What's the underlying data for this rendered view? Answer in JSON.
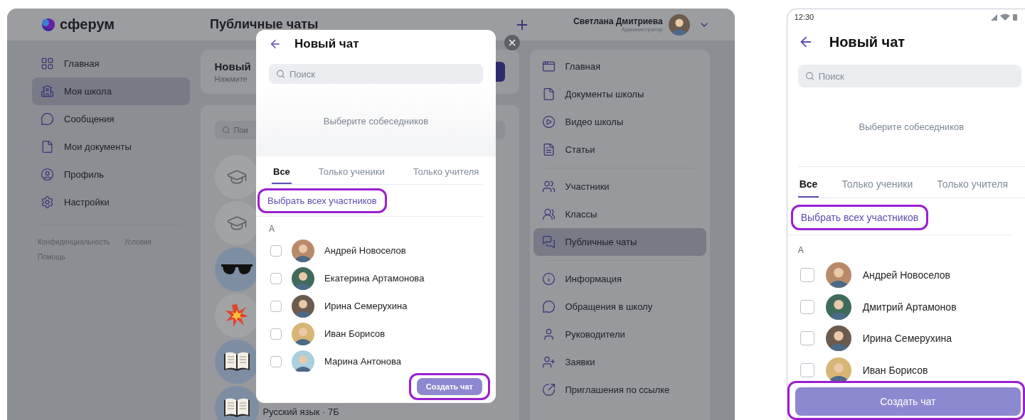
{
  "desktop": {
    "logo": "сферум",
    "page_title": "Публичные чаты",
    "user": {
      "name": "Светлана Дмитриева",
      "role": "Администратор"
    },
    "sidebar": {
      "items": [
        {
          "kind": "grid",
          "label": "Главная",
          "selected": false
        },
        {
          "kind": "school",
          "label": "Моя школа",
          "selected": true
        },
        {
          "kind": "chat",
          "label": "Сообщения",
          "selected": false
        },
        {
          "kind": "file",
          "label": "Мои документы",
          "selected": false
        },
        {
          "kind": "profile",
          "label": "Профиль",
          "selected": false
        },
        {
          "kind": "settings",
          "label": "Настройки",
          "selected": false
        }
      ],
      "links": [
        "Конфиденциальность",
        "Условия",
        "Помощь"
      ]
    },
    "new_chat_card": {
      "title": "Новый",
      "subtitle": "Нажмите"
    },
    "chat_list": {
      "search_placeholder": "Пои",
      "chats": [
        {
          "kind": "cap"
        },
        {
          "kind": "cap"
        },
        {
          "kind": "sunglasses"
        },
        {
          "kind": "explosion"
        },
        {
          "kind": "book"
        },
        {
          "kind": "book",
          "title": "Русский язык · 7Б"
        }
      ]
    },
    "school_menu": {
      "groups": [
        {
          "items": [
            {
              "kind": "window",
              "label": "Главная",
              "selected": false
            },
            {
              "kind": "file",
              "label": "Документы школы",
              "selected": false
            },
            {
              "kind": "play",
              "label": "Видео школы",
              "selected": false
            },
            {
              "kind": "article",
              "label": "Статьи",
              "selected": false
            }
          ]
        },
        {
          "items": [
            {
              "kind": "users",
              "label": "Участники",
              "selected": false
            },
            {
              "kind": "classes",
              "label": "Классы",
              "selected": false
            },
            {
              "kind": "chats",
              "label": "Публичные чаты",
              "selected": true
            }
          ]
        },
        {
          "items": [
            {
              "kind": "info",
              "label": "Информация",
              "selected": false
            },
            {
              "kind": "chat",
              "label": "Обращения в школу",
              "selected": false
            },
            {
              "kind": "user",
              "label": "Руководители",
              "selected": false
            },
            {
              "kind": "requests",
              "label": "Заявки",
              "selected": false
            },
            {
              "kind": "link",
              "label": "Приглашения по ссылке",
              "selected": false
            }
          ]
        }
      ]
    },
    "modal": {
      "title": "Новый чат",
      "search_placeholder": "Поиск",
      "empty_hint": "Выберите собеседников",
      "tabs": [
        {
          "label": "Все",
          "selected": true
        },
        {
          "label": "Только ученики",
          "selected": false
        },
        {
          "label": "Только учителя",
          "selected": false
        }
      ],
      "select_all": "Выбрать всех участников",
      "section": "А",
      "contacts": [
        {
          "name": "Андрей Новоселов",
          "checked": false
        },
        {
          "name": "Екатерина Артамонова",
          "checked": false
        },
        {
          "name": "Ирина Семерухина",
          "checked": false
        },
        {
          "name": "Иван Борисов",
          "checked": false
        },
        {
          "name": "Марина Антонова",
          "checked": false
        }
      ],
      "create_button": {
        "label": "Создать чат",
        "disabled": true
      }
    }
  },
  "mobile": {
    "time": "12:30",
    "title": "Новый чат",
    "search_placeholder": "Поиск",
    "empty_hint": "Выберите собеседников",
    "tabs": [
      {
        "label": "Все",
        "selected": true
      },
      {
        "label": "Только ученики",
        "selected": false
      },
      {
        "label": "Только учителя",
        "selected": false
      }
    ],
    "select_all": "Выбрать всех участников",
    "section": "А",
    "contacts": [
      {
        "name": "Андрей Новоселов",
        "checked": false
      },
      {
        "name": "Дмитрий Артамонов",
        "checked": false
      },
      {
        "name": "Ирина Семерухина",
        "checked": false
      },
      {
        "name": "Иван Борисов",
        "checked": false
      }
    ],
    "create_button": {
      "label": "Создать чат",
      "disabled": true
    }
  }
}
